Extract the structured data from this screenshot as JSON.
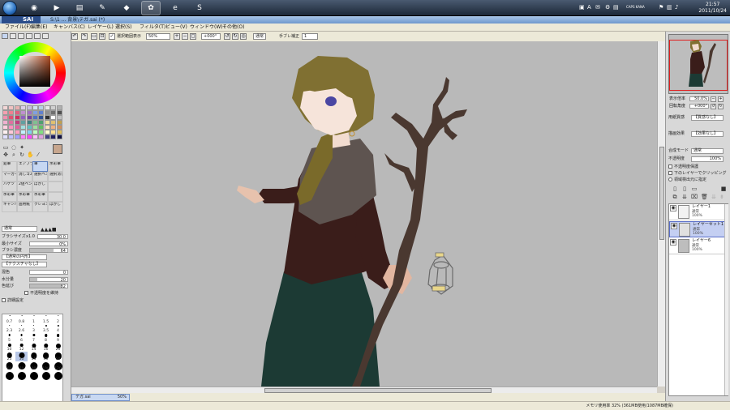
{
  "taskbar": {
    "buttons": [
      {
        "icon": "ie-icon",
        "label": ""
      },
      {
        "icon": "media-player-icon",
        "label": ""
      },
      {
        "icon": "folder-icon",
        "label": ""
      },
      {
        "icon": "notepad-icon",
        "label": ""
      },
      {
        "icon": "game-icon",
        "label": ""
      },
      {
        "icon": "sai-icon",
        "label": ""
      },
      {
        "icon": "browser-icon",
        "label": ""
      },
      {
        "icon": "skype-icon",
        "label": ""
      }
    ],
    "clock_time": "21:57",
    "clock_date": "2011/10/24",
    "tray_label": "CAPS KANA"
  },
  "window": {
    "app_name": "SAI",
    "title": "S:\\1 ... 背景\\テガ.sai (*)"
  },
  "menu": [
    "ファイル(F)",
    "編集(E)",
    "キャンバス(C)",
    "レイヤー(L)",
    "選択(S)",
    "フィルタ(T)",
    "ビュー(V)",
    "ウィンドウ(W)",
    "その他(O)"
  ],
  "toolbar": {
    "show_selection_label": "選択範囲表示",
    "zoom": "50%",
    "rotation": "+000°",
    "blend_mode": "通常",
    "stabilizer_label": "手ブレ補正",
    "stabilizer_value": "1"
  },
  "colors": {
    "accent": "#5b7fbf",
    "canvas_bg": "#b9b9b9",
    "foreground": "#c7a68e",
    "swatches": [
      "#f2d6d6",
      "#f0c2c2",
      "#e6b0b0",
      "#dcd0e8",
      "#c8c0e0",
      "#d0e0f0",
      "#b8d0e8",
      "#e8e8e8",
      "#d0d0d0",
      "#b0b0b0",
      "#f5a0b0",
      "#f08090",
      "#e06080",
      "#c090d0",
      "#a070c0",
      "#80a0e0",
      "#6080d0",
      "#909090",
      "#707070",
      "#505050",
      "#f090b0",
      "#e05070",
      "#d03060",
      "#9060c0",
      "#7040a0",
      "#5070c0",
      "#305090",
      "#303030",
      "#ffffff",
      "#c0c0c0",
      "#f0b0d0",
      "#e070a0",
      "#c04080",
      "#60a0a0",
      "#408080",
      "#80c090",
      "#50a070",
      "#f0e0a0",
      "#e0c070",
      "#c0a050",
      "#ffd0e0",
      "#ff90c0",
      "#e060a0",
      "#a0e0e0",
      "#60c0c0",
      "#a0e0a0",
      "#60c060",
      "#ffe0c0",
      "#f0b080",
      "#d09060",
      "#fff0f0",
      "#ffc8d8",
      "#ffa0c0",
      "#c0f0ff",
      "#80d0f0",
      "#c0ffc0",
      "#80e080",
      "#ffffd0",
      "#ffe090",
      "#e0c060",
      "#e0e0ff",
      "#c0c0ff",
      "#a0a0ff",
      "#ff80ff",
      "#ff40ff",
      "#ffc0ff",
      "#e0a0e0",
      "#404080",
      "#202060",
      "#101040"
    ]
  },
  "tools": [
    {
      "label": "鉛筆",
      "sel": false
    },
    {
      "label": "エアブラシ",
      "sel": false
    },
    {
      "label": "筆",
      "sel": true
    },
    {
      "label": "水彩筆",
      "sel": false
    },
    {
      "label": "マーカー",
      "sel": false
    },
    {
      "label": "消しゴム",
      "sel": false
    },
    {
      "label": "選択ペン",
      "sel": false
    },
    {
      "label": "選択消し",
      "sel": false
    },
    {
      "label": "バケツ",
      "sel": false
    },
    {
      "label": "2値ペン",
      "sel": false
    },
    {
      "label": "ぼかし",
      "sel": false
    },
    {
      "label": "",
      "sel": false
    },
    {
      "label": "水彩筆",
      "sel": false
    },
    {
      "label": "水彩筆",
      "sel": false
    },
    {
      "label": "水彩筆",
      "sel": false
    },
    {
      "label": "",
      "sel": false
    },
    {
      "label": "キャンバス",
      "sel": false
    },
    {
      "label": "画用紙",
      "sel": false
    },
    {
      "label": "クレヨン",
      "sel": false
    },
    {
      "label": "ぼかし",
      "sel": false
    }
  ],
  "brush": {
    "blend": "通常",
    "size_label": "ブラシサイズ",
    "size_mult": "x1.0",
    "size_value": "30.0",
    "min_size_label": "最小サイズ",
    "min_size_value": "0%",
    "density_label": "ブラシ濃度",
    "density_value": "64",
    "shape": "【通常の円形】",
    "texture": "【テクスチャなし】",
    "blending_label": "混色",
    "blending_value": "0",
    "water_label": "水分量",
    "water_value": "20",
    "persistence_label": "色延び",
    "persistence_value": "82",
    "keep_opacity_label": "不透明度を維持",
    "detail_label": "詳細設定",
    "density_fill": 0.64,
    "water_fill": 0.2,
    "persistence_fill": 0.82
  },
  "size_presets": [
    {
      "label": "0.7",
      "d": 0.6,
      "sel": false
    },
    {
      "label": "0.8",
      "d": 0.8,
      "sel": false
    },
    {
      "label": "1",
      "d": 1,
      "sel": false
    },
    {
      "label": "1.5",
      "d": 1.2,
      "sel": false
    },
    {
      "label": "2",
      "d": 1.4,
      "sel": false
    },
    {
      "label": "2.3",
      "d": 1.5,
      "sel": false
    },
    {
      "label": "2.6",
      "d": 1.7,
      "sel": false
    },
    {
      "label": "3",
      "d": 1.9,
      "sel": false
    },
    {
      "label": "3.5",
      "d": 2.1,
      "sel": false
    },
    {
      "label": "4",
      "d": 2.3,
      "sel": false
    },
    {
      "label": "5",
      "d": 2.6,
      "sel": false
    },
    {
      "label": "6",
      "d": 2.9,
      "sel": false
    },
    {
      "label": "7",
      "d": 3.2,
      "sel": false
    },
    {
      "label": "8",
      "d": 3.5,
      "sel": false
    },
    {
      "label": "9",
      "d": 3.8,
      "sel": false
    },
    {
      "label": "10",
      "d": 4.1,
      "sel": false
    },
    {
      "label": "12",
      "d": 4.6,
      "sel": false
    },
    {
      "label": "14",
      "d": 5.1,
      "sel": false
    },
    {
      "label": "16",
      "d": 5.5,
      "sel": false
    },
    {
      "label": "20",
      "d": 6,
      "sel": false
    },
    {
      "label": "25",
      "d": 6.5,
      "sel": false
    },
    {
      "label": "30",
      "d": 7,
      "sel": true
    },
    {
      "label": "35",
      "d": 7.4,
      "sel": false
    },
    {
      "label": "40",
      "d": 7.8,
      "sel": false
    },
    {
      "label": "50",
      "d": 8.2,
      "sel": false
    },
    {
      "label": "60",
      "d": 8.6,
      "sel": false
    },
    {
      "label": "70",
      "d": 9,
      "sel": false
    },
    {
      "label": "80",
      "d": 9.4,
      "sel": false
    },
    {
      "label": "100",
      "d": 9.8,
      "sel": false
    },
    {
      "label": "120",
      "d": 10,
      "sel": false
    },
    {
      "label": "",
      "d": 10,
      "sel": false
    },
    {
      "label": "",
      "d": 10,
      "sel": false
    },
    {
      "label": "",
      "d": 10,
      "sel": false
    },
    {
      "label": "",
      "d": 10,
      "sel": false
    },
    {
      "label": "",
      "d": 10,
      "sel": false
    }
  ],
  "right_panel": {
    "zoom_label": "表示倍率",
    "zoom_value": "50.0%",
    "angle_label": "回転角度",
    "angle_value": "+000°",
    "paper_label": "用紙質感",
    "paper_value": "【質感なし】",
    "effect_label": "描画効果",
    "effect_value": "【効果なし】",
    "blend_label": "合成モード",
    "blend_value": "通常",
    "opacity_label": "不透明度",
    "opacity_value": "100%",
    "protect_label": "不透明度保護",
    "clip_label": "下のレイヤーでクリッピング",
    "ref_label": "領域検出元に指定"
  },
  "layers": [
    {
      "name": "レイヤー1",
      "mode": "通常",
      "op": "100%",
      "sel": false
    },
    {
      "name": "レイヤーセット1",
      "mode": "通常",
      "op": "100%",
      "sel": true
    },
    {
      "name": "レイヤー6",
      "mode": "通常",
      "op": "100%",
      "sel": false
    }
  ],
  "document": {
    "tab": "テガ.sai",
    "tab_zoom": "50%"
  },
  "status": {
    "memory": "メモリ使用率 32% (361MB使用/1087MB確保)"
  }
}
